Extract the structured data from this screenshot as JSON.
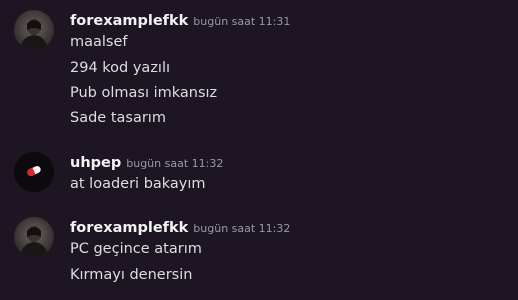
{
  "messages": [
    {
      "author": "forexamplefkk",
      "timestamp": "bugün saat 11:31",
      "avatar_icon": "dark-figure-avatar",
      "lines": [
        "maalsef",
        "294 kod yazılı",
        "Pub olması imkansız",
        "Sade tasarım"
      ]
    },
    {
      "author": "uhpep",
      "timestamp": "bugün saat 11:32",
      "avatar_icon": "pill-capsule-avatar",
      "lines": [
        "at loaderi bakayım"
      ]
    },
    {
      "author": "forexamplefkk",
      "timestamp": "bugün saat 11:32",
      "avatar_icon": "dark-figure-avatar",
      "lines": [
        "PC geçince atarım",
        "Kırmayı denersin"
      ]
    }
  ],
  "colors": {
    "background": "#1e1522",
    "username": "#f2f3f5",
    "timestamp": "#949ba4",
    "message_text": "#dbdee1"
  }
}
